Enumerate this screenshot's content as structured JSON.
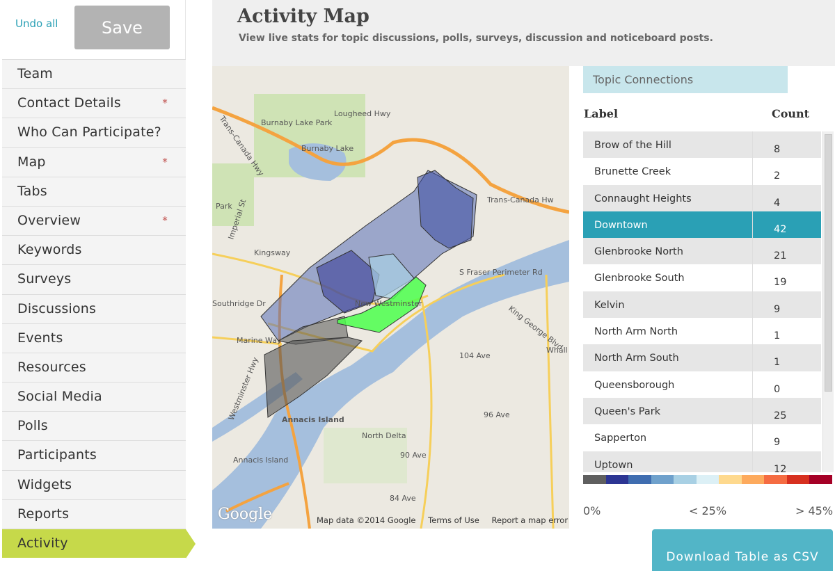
{
  "topbar": {
    "undo_label": "Undo all",
    "save_label": "Save"
  },
  "sidebar": {
    "items": [
      {
        "label": "Team",
        "required": false
      },
      {
        "label": "Contact Details",
        "required": true
      },
      {
        "label": "Who Can Participate?",
        "required": false
      },
      {
        "label": "Map",
        "required": true
      },
      {
        "label": "Tabs",
        "required": false
      },
      {
        "label": "Overview",
        "required": true
      },
      {
        "label": "Keywords",
        "required": false
      },
      {
        "label": "Surveys",
        "required": false
      },
      {
        "label": "Discussions",
        "required": false
      },
      {
        "label": "Events",
        "required": false
      },
      {
        "label": "Resources",
        "required": false
      },
      {
        "label": "Social Media",
        "required": false
      },
      {
        "label": "Polls",
        "required": false
      },
      {
        "label": "Participants",
        "required": false
      },
      {
        "label": "Widgets",
        "required": false
      },
      {
        "label": "Reports",
        "required": false
      },
      {
        "label": "Activity",
        "required": false,
        "active": true
      }
    ],
    "required_mark": "*"
  },
  "header": {
    "title": "Activity Map",
    "subtitle": "View live stats for topic discussions, polls, surveys, discussion and noticeboard posts."
  },
  "map": {
    "labels": {
      "burnaby_lake_park": "Burnaby Lake Park",
      "burnaby_lake": "Burnaby Lake",
      "lougheed": "Lougheed Hwy",
      "trans_canada": "Trans-Canada Hwy",
      "trans_canada_right": "Trans-Canada Hw",
      "kingsway": "Kingsway",
      "imperial": "Imperial St",
      "new_west": "New Westminster",
      "fraser_perimeter": "S Fraser Perimeter Rd",
      "king_george": "King George Blvd",
      "marine": "Marine Way",
      "annacis": "Annacis Island",
      "annacis2": "Annacis Island",
      "north_delta": "North Delta",
      "ave96": "96 Ave",
      "ave104": "104 Ave",
      "ave90": "90 Ave",
      "ave84": "84 Ave",
      "southridge": "Southridge Dr",
      "whall": "Whall",
      "park": "Park",
      "westminster_hwy": "Westminster Hwy"
    },
    "attribution": {
      "data": "Map data ©2014 Google",
      "terms": "Terms of Use",
      "report": "Report a map error"
    },
    "logo": "Google",
    "colors": {
      "water": "#a5bfdd",
      "highlight": "#4cff4c",
      "region_blue": "#5a6fb8",
      "region_grey": "#555555"
    }
  },
  "panel": {
    "tab_label": "Topic Connections",
    "columns": {
      "label": "Label",
      "count": "Count"
    },
    "rows": [
      {
        "label": "Brow of the Hill",
        "count": "8"
      },
      {
        "label": "Brunette Creek",
        "count": "2"
      },
      {
        "label": "Connaught Heights",
        "count": "4"
      },
      {
        "label": "Downtown",
        "count": "42",
        "selected": true
      },
      {
        "label": "Glenbrooke North",
        "count": "21"
      },
      {
        "label": "Glenbrooke South",
        "count": "19"
      },
      {
        "label": "Kelvin",
        "count": "9"
      },
      {
        "label": "North Arm North",
        "count": "1"
      },
      {
        "label": "North Arm South",
        "count": "1"
      },
      {
        "label": "Queensborough",
        "count": "0"
      },
      {
        "label": "Queen's Park",
        "count": "25"
      },
      {
        "label": "Sapperton",
        "count": "9"
      },
      {
        "label": "Uptown",
        "count": "12"
      }
    ],
    "legend": {
      "colors": [
        "#5f5f5f",
        "#2c3593",
        "#3f6db0",
        "#6fa1cc",
        "#a8d0e4",
        "#dcf0f6",
        "#fed98e",
        "#fdaa5d",
        "#f56c42",
        "#d7301f",
        "#a50026"
      ],
      "min_label": "0%",
      "mid_label": "< 25%",
      "max_label": "> 45%"
    },
    "download_label": "Download Table as CSV",
    "accent": "#2aa0b5"
  }
}
